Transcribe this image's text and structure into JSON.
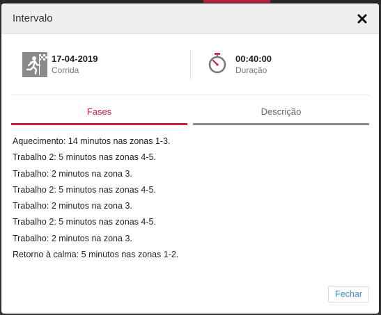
{
  "modal": {
    "title": "Intervalo",
    "close_icon": "close-icon"
  },
  "summary": {
    "date": "17-04-2019",
    "sport": "Corrida",
    "sport_icon": "running-icon",
    "duration": "00:40:00",
    "duration_label": "Duração",
    "duration_icon": "stopwatch-icon"
  },
  "tabs": [
    {
      "label": "Fases",
      "active": true
    },
    {
      "label": "Descrição",
      "active": false
    }
  ],
  "phases": [
    "Aquecimento: 14 minutos nas zonas 1-3.",
    "Trabalho 2: 5 minutos nas zonas 4-5.",
    "Trabalho: 2 minutos na zona 3.",
    "Trabalho 2: 5 minutos nas zonas 4-5.",
    "Trabalho: 2 minutos na zona 3.",
    "Trabalho 2: 5 minutos nas zonas 4-5.",
    "Trabalho: 2 minutos na zona 3.",
    "Retorno à calma: 5 minutos nas zonas 1-2."
  ],
  "footer": {
    "close_label": "Fechar"
  },
  "colors": {
    "accent": "#c9233f",
    "link": "#3a8fc6"
  }
}
